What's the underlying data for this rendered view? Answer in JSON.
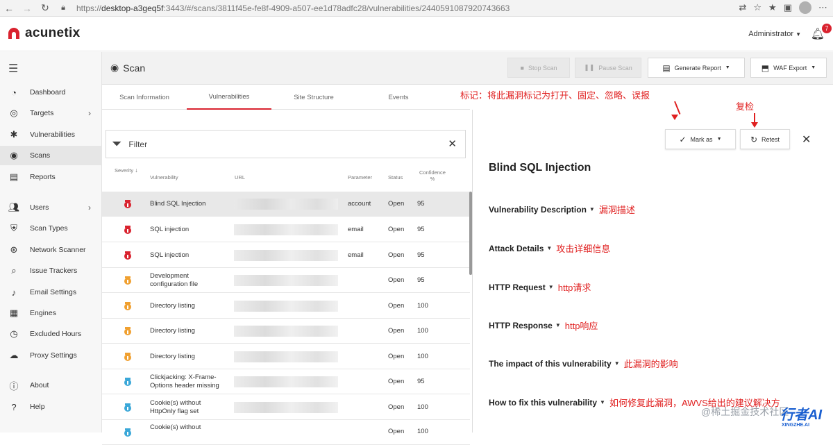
{
  "browser": {
    "url_prefix": "https://",
    "url_host": "desktop-a3geq5f",
    "url_rest": ":3443/#/scans/3811f45e-fe8f-4909-a507-ee1d78adfc28/vulnerabilities/2440591087920743663"
  },
  "app": {
    "logo": "acunetix",
    "user": "Administrator",
    "notifications": "7"
  },
  "sidebar": {
    "items": [
      {
        "label": "Dashboard",
        "icon": "dashboard-icon"
      },
      {
        "label": "Targets",
        "icon": "target-icon"
      },
      {
        "label": "Vulnerabilities",
        "icon": "bug-icon"
      },
      {
        "label": "Scans",
        "icon": "radar-icon"
      },
      {
        "label": "Reports",
        "icon": "document-icon"
      },
      {
        "label": "Users",
        "icon": "users-icon"
      },
      {
        "label": "Scan Types",
        "icon": "shield-icon"
      },
      {
        "label": "Network Scanner",
        "icon": "network-icon"
      },
      {
        "label": "Issue Trackers",
        "icon": "tracker-icon"
      },
      {
        "label": "Email Settings",
        "icon": "bell-icon"
      },
      {
        "label": "Engines",
        "icon": "chip-icon"
      },
      {
        "label": "Excluded Hours",
        "icon": "clock-icon"
      },
      {
        "label": "Proxy Settings",
        "icon": "cloud-icon"
      },
      {
        "label": "About",
        "icon": "info-icon"
      },
      {
        "label": "Help",
        "icon": "help-icon"
      }
    ]
  },
  "header": {
    "title": "Scan",
    "stop_scan": "Stop Scan",
    "pause_scan": "Pause Scan",
    "generate_report": "Generate Report",
    "waf_export": "WAF Export"
  },
  "tabs": [
    "Scan Information",
    "Vulnerabilities",
    "Site Structure",
    "Events"
  ],
  "filter": {
    "label": "Filter"
  },
  "table": {
    "headers": {
      "severity": "Severity",
      "vulnerability": "Vulnerability",
      "url": "URL",
      "parameter": "Parameter",
      "status": "Status",
      "confidence_1": "Confidence",
      "confidence_2": "%"
    },
    "rows": [
      {
        "severity": "high",
        "name1": "Blind SQL Injection",
        "name2": "",
        "param": "account",
        "status": "Open",
        "conf": "95"
      },
      {
        "severity": "high",
        "name1": "SQL injection",
        "name2": "",
        "param": "email",
        "status": "Open",
        "conf": "95"
      },
      {
        "severity": "high",
        "name1": "SQL injection",
        "name2": "",
        "param": "email",
        "status": "Open",
        "conf": "95"
      },
      {
        "severity": "medium",
        "name1": "Development",
        "name2": "configuration file",
        "param": "",
        "status": "Open",
        "conf": "95"
      },
      {
        "severity": "medium",
        "name1": "Directory listing",
        "name2": "",
        "param": "",
        "status": "Open",
        "conf": "100"
      },
      {
        "severity": "medium",
        "name1": "Directory listing",
        "name2": "",
        "param": "",
        "status": "Open",
        "conf": "100"
      },
      {
        "severity": "medium",
        "name1": "Directory listing",
        "name2": "",
        "param": "",
        "status": "Open",
        "conf": "100"
      },
      {
        "severity": "low",
        "name1": "Clickjacking: X-Frame-",
        "name2": "Options header missing",
        "param": "",
        "status": "Open",
        "conf": "95"
      },
      {
        "severity": "low",
        "name1": "Cookie(s) without",
        "name2": "HttpOnly flag set",
        "param": "",
        "status": "Open",
        "conf": "100"
      },
      {
        "severity": "low",
        "name1": "Cookie(s) without",
        "name2": "",
        "param": "",
        "status": "Open",
        "conf": "100"
      }
    ]
  },
  "detail": {
    "mark_as": "Mark as",
    "retest": "Retest",
    "title": "Blind SQL Injection",
    "sections": [
      {
        "label": "Vulnerability Description",
        "note": "漏洞描述"
      },
      {
        "label": "Attack Details",
        "note": "攻击详细信息"
      },
      {
        "label": "HTTP Request",
        "note": "http请求"
      },
      {
        "label": "HTTP Response",
        "note": "http响应"
      },
      {
        "label": "The impact of this vulnerability",
        "note": "此漏洞的影响"
      },
      {
        "label": "How to fix this vulnerability",
        "note": "如何修复此漏洞，AWVS给出的建议解决方"
      }
    ]
  },
  "annotations": {
    "mark_note": "标记：将此漏洞标记为打开、固定、忽略、误报",
    "retest_note": "复检"
  },
  "watermark": {
    "text": "@稀土掘金技术社区",
    "brand": "XINGZHE.AI"
  },
  "colors": {
    "brand_red": "#d9232f",
    "high": "#d9232f",
    "medium": "#f0a030",
    "low": "#3aa7d8",
    "annotation": "#e02020"
  }
}
